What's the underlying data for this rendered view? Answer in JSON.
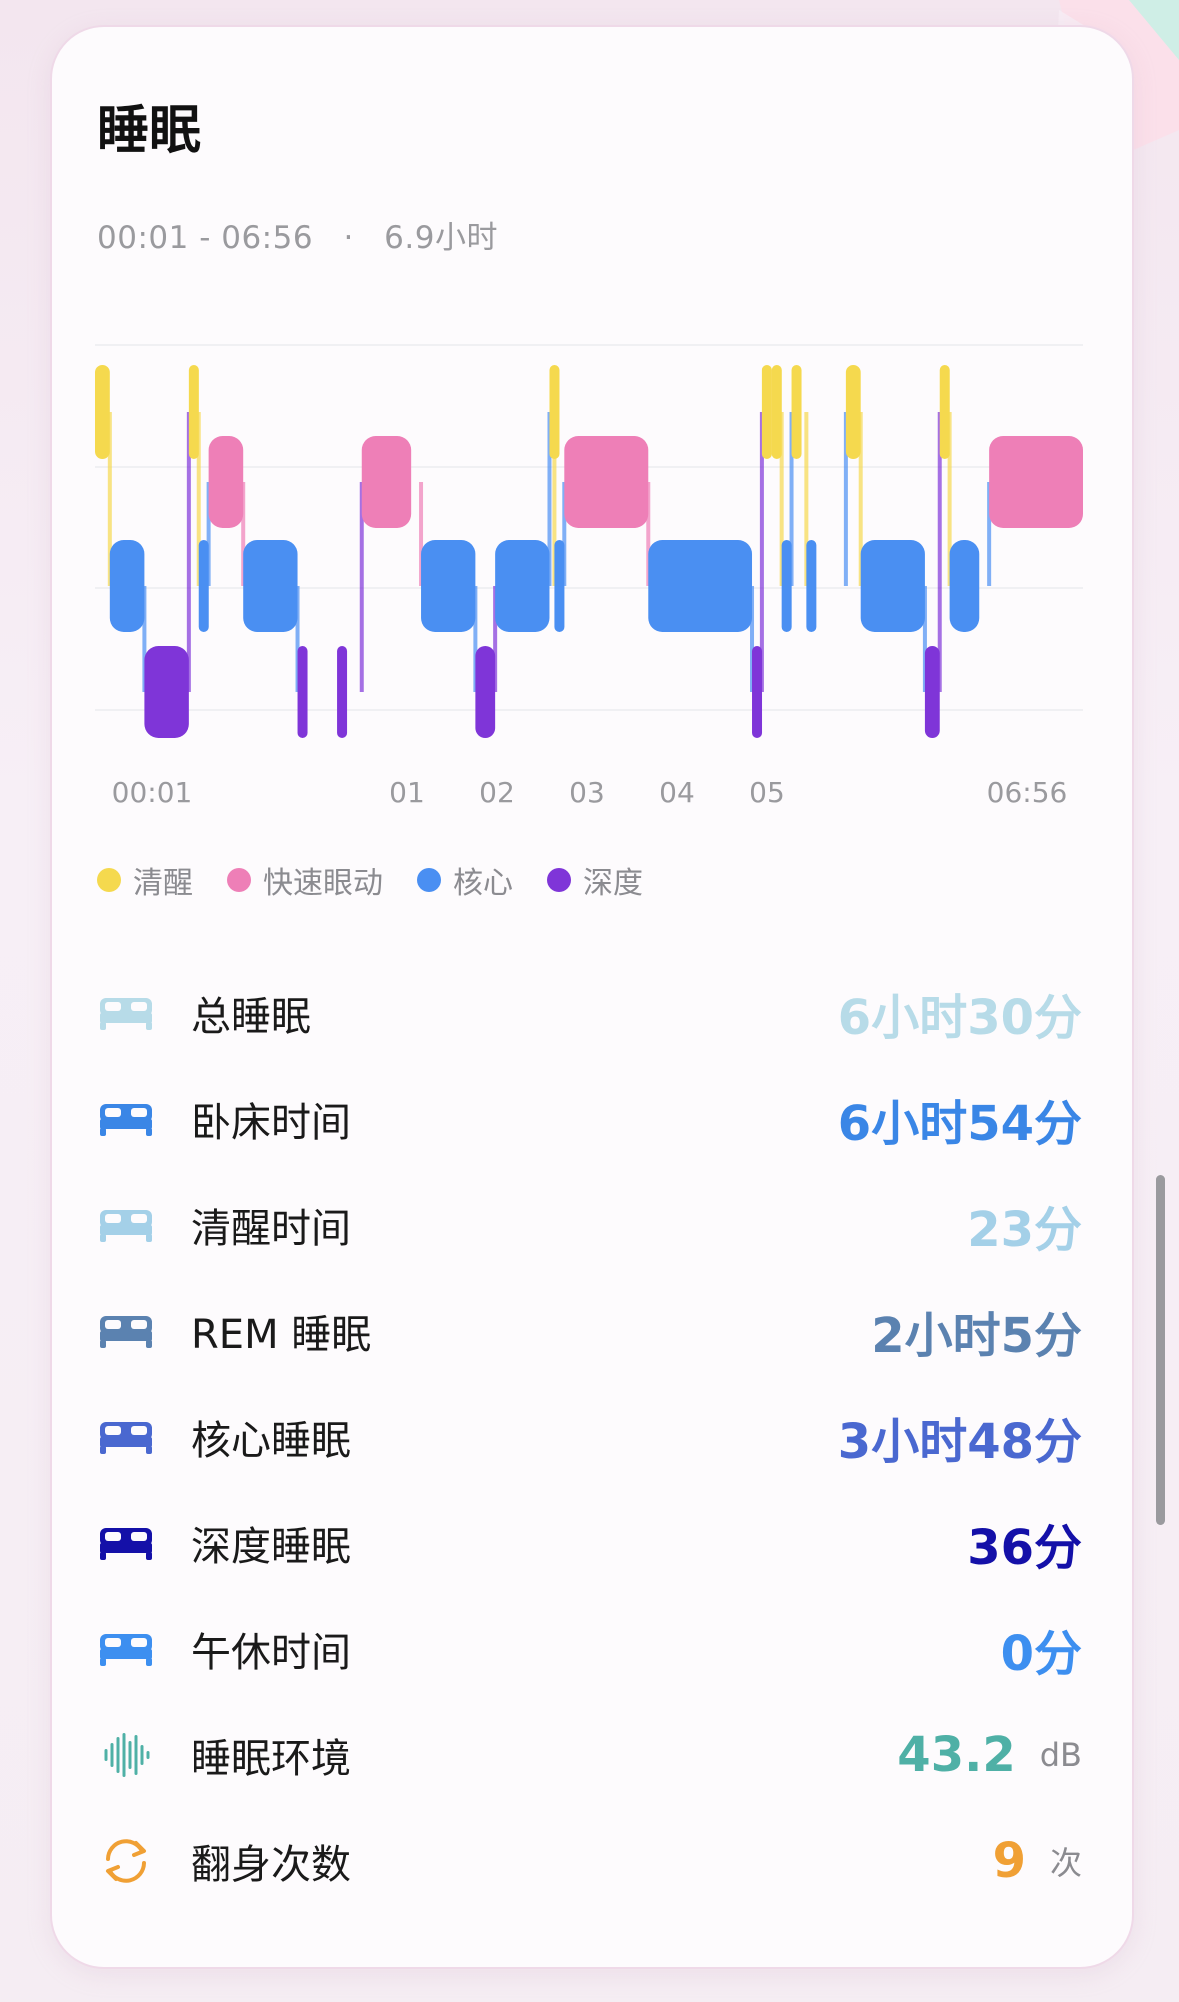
{
  "card": {
    "title": "睡眠",
    "time_range": "00:01 - 06:56",
    "separator": "·",
    "duration": "6.9小时"
  },
  "colors": {
    "awake": "#f5d94e",
    "rem": "#ee7fb7",
    "core": "#4a8ff2",
    "deep": "#7f35d8"
  },
  "chart_data": {
    "type": "timeline",
    "time_start": "00:01",
    "time_end": "06:56",
    "stages": [
      "清醒",
      "快速眼动",
      "核心",
      "深度"
    ],
    "x_tick_labels": [
      "00:01",
      "01",
      "02",
      "03",
      "04",
      "05",
      "06:56"
    ],
    "segments": [
      {
        "stage": "awake",
        "start": 0.0,
        "end": 0.15
      },
      {
        "stage": "core",
        "start": 0.15,
        "end": 0.5
      },
      {
        "stage": "deep",
        "start": 0.5,
        "end": 0.95
      },
      {
        "stage": "awake",
        "start": 0.95,
        "end": 1.0
      },
      {
        "stage": "core",
        "start": 1.05,
        "end": 1.15
      },
      {
        "stage": "rem",
        "start": 1.15,
        "end": 1.5
      },
      {
        "stage": "core",
        "start": 1.5,
        "end": 2.05
      },
      {
        "stage": "deep",
        "start": 2.05,
        "end": 2.15
      },
      {
        "stage": "deep",
        "start": 2.45,
        "end": 2.55
      },
      {
        "stage": "rem",
        "start": 2.7,
        "end": 3.2
      },
      {
        "stage": "core",
        "start": 3.3,
        "end": 3.85
      },
      {
        "stage": "deep",
        "start": 3.85,
        "end": 4.05
      },
      {
        "stage": "core",
        "start": 4.05,
        "end": 4.6
      },
      {
        "stage": "awake",
        "start": 4.6,
        "end": 4.65
      },
      {
        "stage": "core",
        "start": 4.65,
        "end": 4.75
      },
      {
        "stage": "rem",
        "start": 4.75,
        "end": 5.6
      },
      {
        "stage": "core",
        "start": 5.6,
        "end": 6.65
      },
      {
        "stage": "deep",
        "start": 6.65,
        "end": 6.75
      },
      {
        "stage": "awake",
        "start": 6.75,
        "end": 6.85
      },
      {
        "stage": "awake",
        "start": 6.85,
        "end": 6.95
      },
      {
        "stage": "core",
        "start": 6.95,
        "end": 7.05
      },
      {
        "stage": "awake",
        "start": 7.05,
        "end": 7.15
      },
      {
        "stage": "core",
        "start": 7.2,
        "end": 7.3
      },
      {
        "stage": "awake",
        "start": 7.6,
        "end": 7.75
      },
      {
        "stage": "core",
        "start": 7.75,
        "end": 8.4
      },
      {
        "stage": "deep",
        "start": 8.4,
        "end": 8.55
      },
      {
        "stage": "awake",
        "start": 8.55,
        "end": 8.65
      },
      {
        "stage": "core",
        "start": 8.65,
        "end": 8.95
      },
      {
        "stage": "rem",
        "start": 9.05,
        "end": 10.0
      }
    ]
  },
  "legend": [
    {
      "label": "清醒",
      "color": "#f5d94e"
    },
    {
      "label": "快速眼动",
      "color": "#ee7fb7"
    },
    {
      "label": "核心",
      "color": "#4a8ff2"
    },
    {
      "label": "深度",
      "color": "#7f35d8"
    }
  ],
  "stats": [
    {
      "icon": "bed-icon",
      "label": "总睡眠",
      "value": "6小时30分",
      "unit": "",
      "color": "#b7dbe8",
      "icon_color": "#b7dbe8"
    },
    {
      "icon": "bed-icon",
      "label": "卧床时间",
      "value": "6小时54分",
      "unit": "",
      "color": "#3a86e6",
      "icon_color": "#3a86e6"
    },
    {
      "icon": "bed-icon",
      "label": "清醒时间",
      "value": "23分",
      "unit": "",
      "color": "#a4d0e8",
      "icon_color": "#a4d0e8"
    },
    {
      "icon": "bed-icon",
      "label": "REM 睡眠",
      "value": "2小时5分",
      "unit": "",
      "color": "#5b82b0",
      "icon_color": "#5b82b0"
    },
    {
      "icon": "bed-icon",
      "label": "核心睡眠",
      "value": "3小时48分",
      "unit": "",
      "color": "#4a68d0",
      "icon_color": "#4a68d0"
    },
    {
      "icon": "bed-icon",
      "label": "深度睡眠",
      "value": "36分",
      "unit": "",
      "color": "#1410a8",
      "icon_color": "#1410a8"
    },
    {
      "icon": "bed-icon",
      "label": "午休时间",
      "value": "0分",
      "unit": "",
      "color": "#3d8ff0",
      "icon_color": "#3d8ff0"
    },
    {
      "icon": "sound-wave-icon",
      "label": "睡眠环境",
      "value": "43.2",
      "unit": "dB",
      "color": "#4fb0a6",
      "icon_color": "#4fb0a6"
    },
    {
      "icon": "rotate-icon",
      "label": "翻身次数",
      "value": "9",
      "unit": "次",
      "color": "#f0a035",
      "icon_color": "#f0a035"
    }
  ]
}
